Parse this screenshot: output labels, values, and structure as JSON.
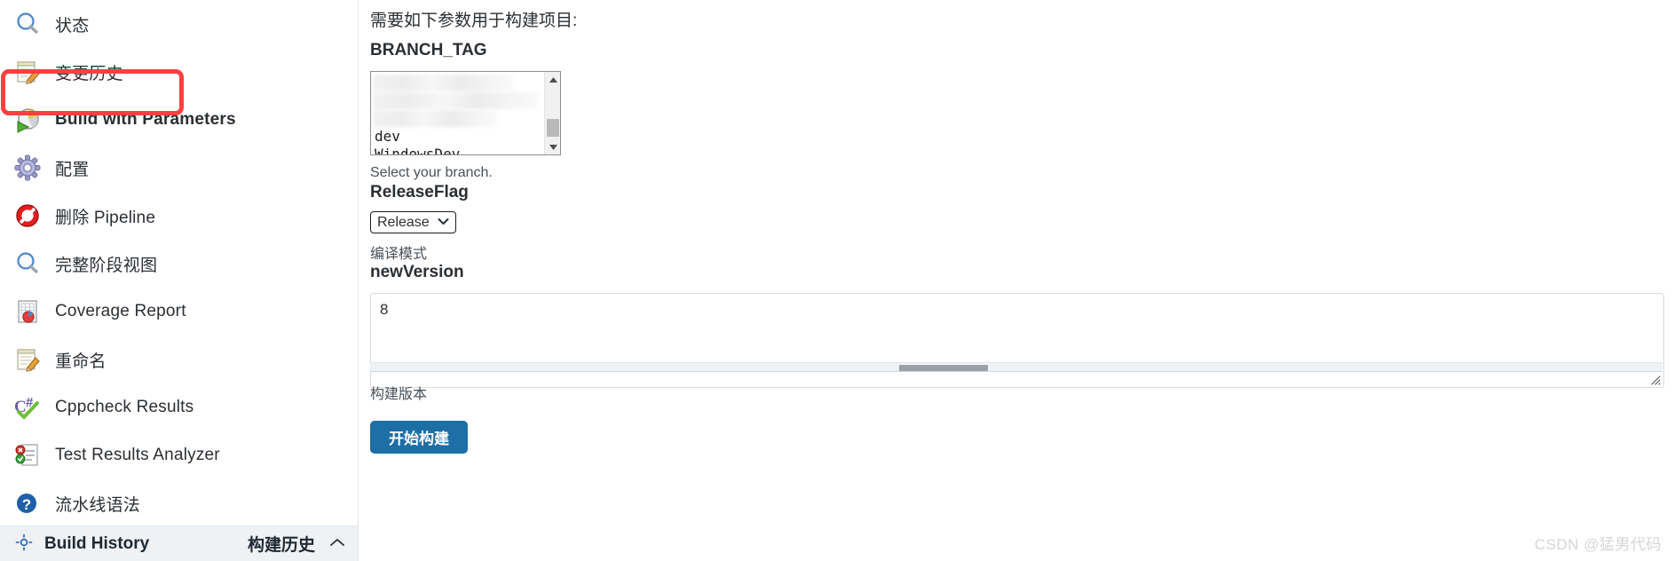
{
  "sidebar": {
    "items": [
      {
        "label": "状态",
        "icon": "magnifier-icon",
        "bold": false
      },
      {
        "label": "变更历史",
        "icon": "notepad-pencil-icon",
        "bold": false
      },
      {
        "label": "Build with Parameters",
        "icon": "build-params-icon",
        "bold": true,
        "highlighted": true
      },
      {
        "label": "配置",
        "icon": "gear-icon",
        "bold": false
      },
      {
        "label": "删除 Pipeline",
        "icon": "delete-forbidden-icon",
        "bold": false
      },
      {
        "label": "完整阶段视图",
        "icon": "magnifier-icon",
        "bold": false
      },
      {
        "label": "Coverage Report",
        "icon": "coverage-report-icon",
        "bold": false
      },
      {
        "label": "重命名",
        "icon": "notepad-pencil-icon",
        "bold": false
      },
      {
        "label": "Cppcheck Results",
        "icon": "cppcheck-icon",
        "bold": false
      },
      {
        "label": "Test Results Analyzer",
        "icon": "test-results-icon",
        "bold": false
      },
      {
        "label": "流水线语法",
        "icon": "help-question-icon",
        "bold": false
      }
    ],
    "build_history": {
      "icon": "weather-sun-icon",
      "title": "Build History",
      "title_cn": "构建历史",
      "chevron": "⌃"
    }
  },
  "main": {
    "intro": "需要如下参数用于构建项目:",
    "params": [
      {
        "name": "BRANCH_TAG",
        "type": "listbox",
        "description": "Select your branch.",
        "options": [
          "",
          "",
          "",
          "dev",
          "WindowsDev"
        ],
        "blurred_count": 3,
        "scroll": {
          "up_arrow": "▲",
          "down_arrow": "▼"
        }
      },
      {
        "name": "ReleaseFlag",
        "type": "select",
        "selected": "Release",
        "chevron": "⌄",
        "description": "编译模式"
      },
      {
        "name": "newVersion",
        "type": "textarea",
        "value": "8",
        "description": "构建版本"
      }
    ],
    "submit_label": "开始构建"
  },
  "watermark": "CSDN @猛男代码",
  "colors": {
    "accent_button": "#1d6fa5",
    "highlight_border": "#f94040",
    "footer_bg": "#eef2f5"
  }
}
